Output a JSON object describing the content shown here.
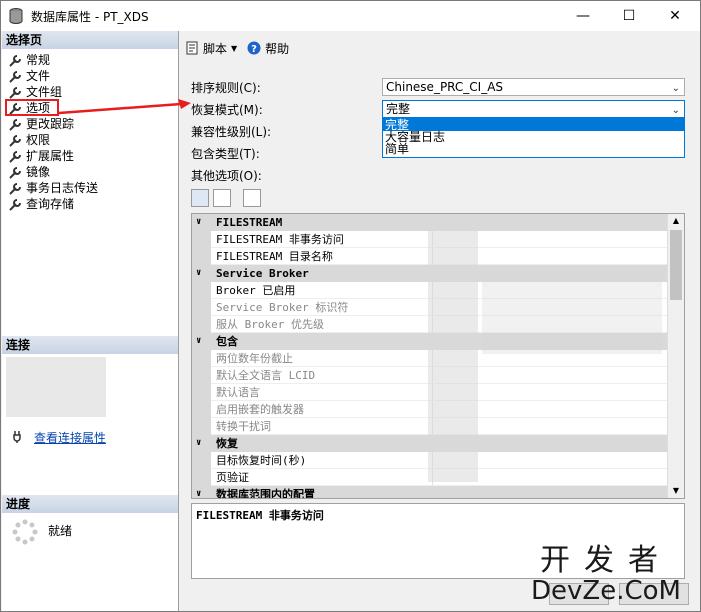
{
  "window": {
    "title": "数据库属性 - PT_XDS"
  },
  "left_panel": {
    "select_page_header": "选择页",
    "nav_items": [
      "常规",
      "文件",
      "文件组",
      "选项",
      "更改跟踪",
      "权限",
      "扩展属性",
      "镜像",
      "事务日志传送",
      "查询存储"
    ],
    "connection_header": "连接",
    "connection_link": "查看连接属性",
    "progress_header": "进度",
    "progress_status": "就绪"
  },
  "toolbar": {
    "script_label": "脚本",
    "help_label": "帮助"
  },
  "form": {
    "collation_label": "排序规则(C):",
    "collation_value": "Chinese_PRC_CI_AS",
    "recovery_label": "恢复模式(M):",
    "recovery_value": "完整",
    "compat_label": "兼容性级别(L):",
    "containment_label": "包含类型(T):",
    "other_options_label": "其他选项(O):",
    "recovery_options": [
      "完整",
      "大容量日志",
      "简单"
    ]
  },
  "property_grid": {
    "rows": [
      {
        "name": "FILESTREAM",
        "type": "category"
      },
      {
        "name": "FILESTREAM 非事务访问",
        "type": "prop",
        "dim": false
      },
      {
        "name": "FILESTREAM 目录名称",
        "type": "prop",
        "dim": false
      },
      {
        "name": "Service Broker",
        "type": "category"
      },
      {
        "name": "Broker 已启用",
        "type": "prop",
        "dim": false
      },
      {
        "name": "Service Broker 标识符",
        "type": "prop",
        "dim": true
      },
      {
        "name": "服从 Broker 优先级",
        "type": "prop",
        "dim": true
      },
      {
        "name": "包含",
        "type": "category"
      },
      {
        "name": "两位数年份截止",
        "type": "prop",
        "dim": true
      },
      {
        "name": "默认全文语言 LCID",
        "type": "prop",
        "dim": true
      },
      {
        "name": "默认语言",
        "type": "prop",
        "dim": true
      },
      {
        "name": "启用嵌套的触发器",
        "type": "prop",
        "dim": true
      },
      {
        "name": "转换干扰词",
        "type": "prop",
        "dim": true
      },
      {
        "name": "恢复",
        "type": "category"
      },
      {
        "name": "目标恢复时间(秒)",
        "type": "prop",
        "dim": false
      },
      {
        "name": "页验证",
        "type": "prop",
        "dim": false
      },
      {
        "name": "数据库范围内的配置",
        "type": "category"
      }
    ]
  },
  "description": {
    "title": "FILESTREAM 非事务访问"
  },
  "watermark": {
    "line1": "开发者",
    "line2": "DevZe.CoM"
  },
  "colors": {
    "accent": "#0078d7",
    "highlight_box": "#e61e1e",
    "link": "#0645ad"
  }
}
